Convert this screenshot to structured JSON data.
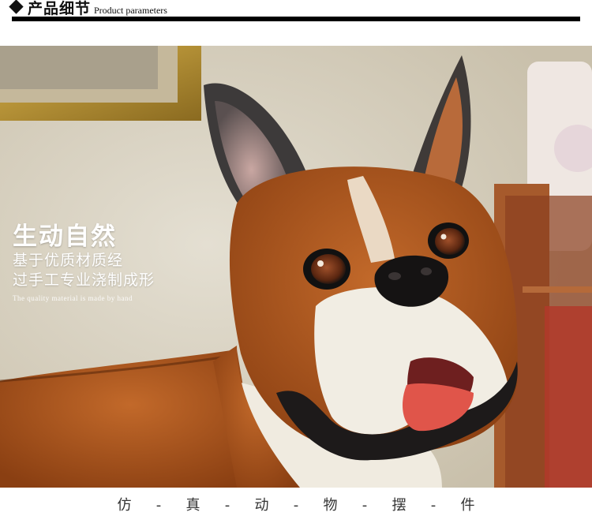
{
  "header": {
    "title": "产品细节",
    "subtitle": "Product parameters"
  },
  "overlay": {
    "headline": "生动自然",
    "line1": "基于优质材质经",
    "line2": "过手工专业浇制成形",
    "english": "The quality material is made by hand"
  },
  "footer": {
    "tagline": [
      "仿",
      "-",
      "真",
      "-",
      "动",
      "-",
      "物",
      "-",
      "摆",
      "-",
      "件"
    ]
  },
  "colors": {
    "accent_rule": "#000000",
    "overlay_text": "#ffffff",
    "dog_fur": "#a8541d",
    "dog_muzzle": "#f1ede3"
  }
}
